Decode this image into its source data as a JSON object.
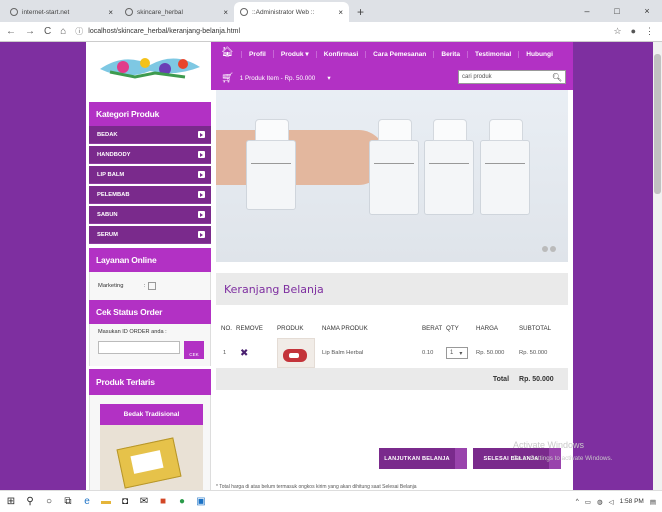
{
  "browser": {
    "tabs": [
      {
        "title": "internet-start.net",
        "active": false
      },
      {
        "title": "skincare_herbal",
        "active": true
      },
      {
        "title": "::Administrator Web ::",
        "active": false
      }
    ],
    "new_tab": "+",
    "url": "localhost/skincare_herbal/keranjang-belanja.html",
    "nav": {
      "back": "←",
      "forward": "→",
      "reload": "C",
      "home": "⌂"
    },
    "window": {
      "minimize": "–",
      "maximize": "□",
      "close": "×"
    }
  },
  "site": {
    "menu": [
      "Profil",
      "Produk ▾",
      "Konfirmasi",
      "Cara Pemesanan",
      "Berita",
      "Testimonial",
      "Hubungi"
    ],
    "cart_summary": "1 Produk Item - Rp. 50.000",
    "cart_dropdown": "▾",
    "search_placeholder": "cari produk"
  },
  "sidebar": {
    "categories_title": "Kategori Produk",
    "categories": [
      "BEDAK",
      "HANDBODY",
      "LIP BALM",
      "PELEMBAB",
      "SABUN",
      "SERUM"
    ],
    "online_title": "Layanan Online",
    "marketing_label": "Marketing",
    "marketing_colon": ":",
    "status_title": "Cek Status Order",
    "order_label": "Masukan ID ORDER anda :",
    "check_button": "CEK",
    "bestseller_title": "Produk Terlaris",
    "bestseller_item": "Bedak Tradisional"
  },
  "cart": {
    "title": "Keranjang Belanja",
    "headers": [
      "NO.",
      "REMOVE",
      "PRODUK",
      "NAMA PRODUK",
      "BERAT",
      "QTY",
      "HARGA",
      "SUBTOTAL"
    ],
    "rows": [
      {
        "no": "1",
        "remove": "✖",
        "name": "Lip Balm Herbal",
        "weight": "0.10",
        "qty": "1",
        "price": "Rp. 50.000",
        "subtotal": "Rp. 50.000"
      }
    ],
    "total_label": "Total",
    "total_value": "Rp. 50.000",
    "continue_button": "LANJUTKAN BELANJA",
    "finish_button": "SELESAI BELANJA",
    "note": "* Total harga di atas belum termasuk ongkos kirim yang akan dihitung saat Selesai Belanja"
  },
  "os": {
    "watermark_title": "Activate Windows",
    "watermark_sub": "Go to Settings to activate Windows.",
    "time": "1:58 PM"
  },
  "colors": {
    "brand": "#b231c4",
    "dark": "#7a2a8c",
    "bg": "#7e2fa0"
  }
}
